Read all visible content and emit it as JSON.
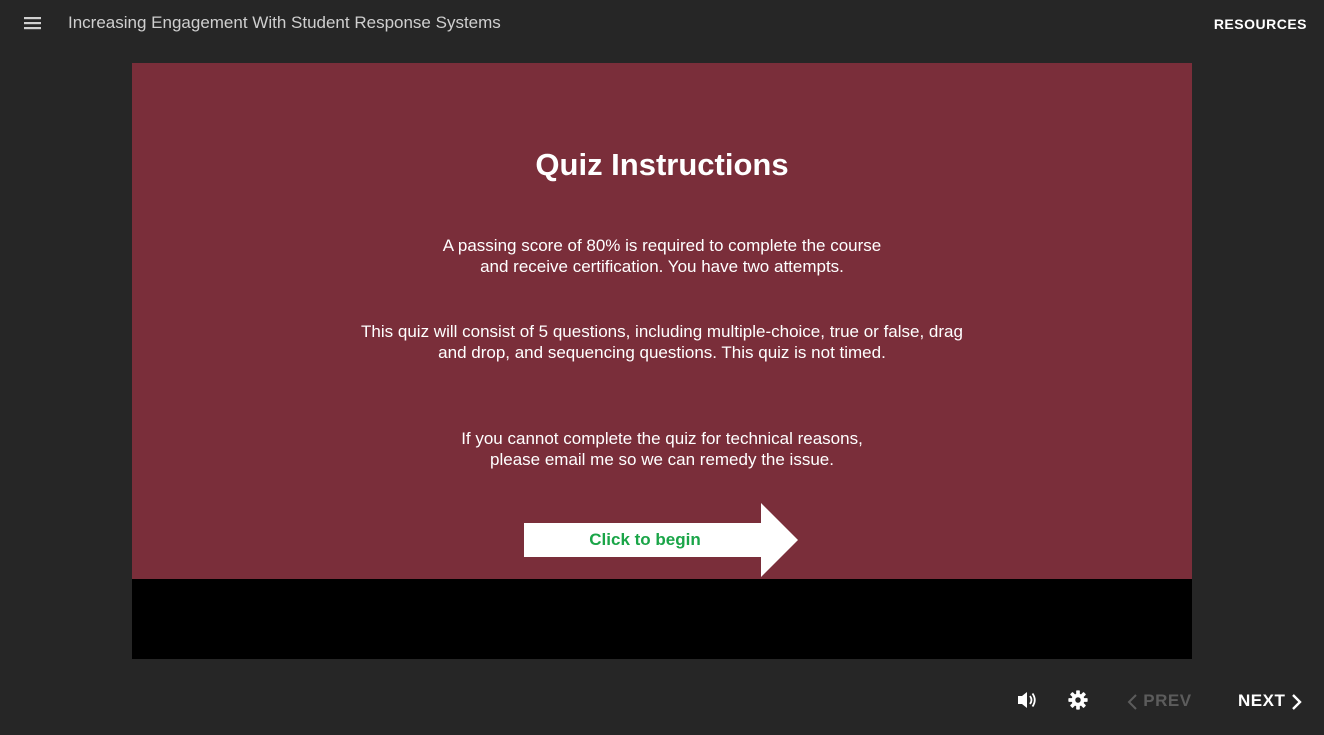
{
  "header": {
    "course_title": "Increasing Engagement With Student Response Systems",
    "resources_label": "RESOURCES",
    "menu_icon": "hamburger-menu-icon"
  },
  "slide": {
    "background_color": "#7a2e3a",
    "title": "Quiz Instructions",
    "paragraphs": [
      "A passing score of 80% is required to complete the course\nand receive certification. You have two attempts.",
      "This quiz will consist of 5 questions, including multiple-choice, true or false, drag\nand drop, and sequencing questions. This quiz is not timed.",
      "If you cannot complete the quiz for technical reasons,\nplease email me so we can remedy the issue."
    ],
    "begin_button": {
      "label": "Click to begin",
      "label_color": "#1aa548",
      "shape": "right-arrow"
    }
  },
  "controls": {
    "volume_icon": "volume-icon",
    "settings_icon": "gear-icon",
    "prev_label": "PREV",
    "next_label": "NEXT",
    "prev_enabled": false,
    "next_enabled": true
  }
}
